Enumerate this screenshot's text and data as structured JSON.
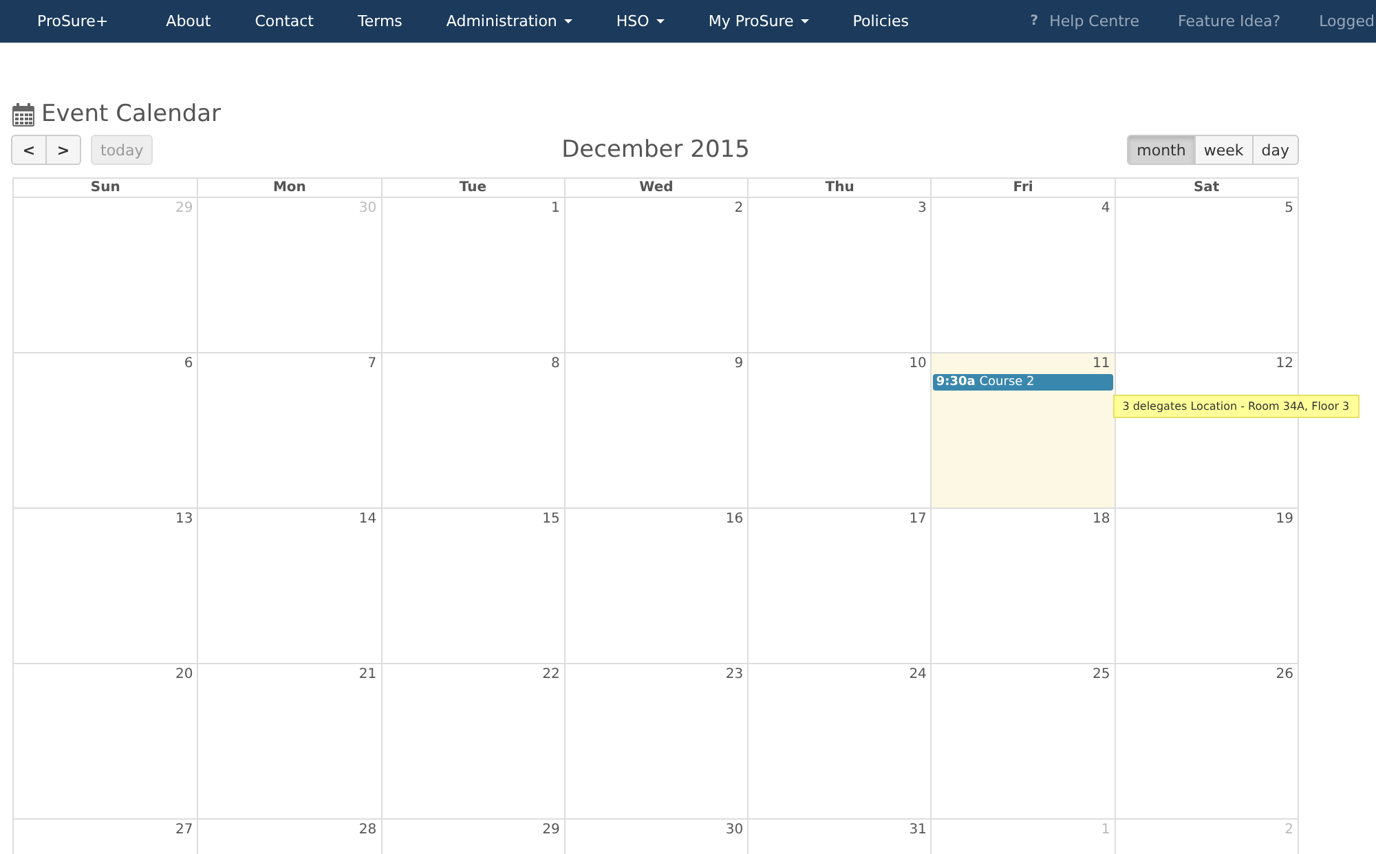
{
  "navbar": {
    "items": [
      {
        "label": "ProSure+",
        "dropdown": false
      },
      {
        "label": "About",
        "dropdown": false
      },
      {
        "label": "Contact",
        "dropdown": false
      },
      {
        "label": "Terms",
        "dropdown": false
      },
      {
        "label": "Administration",
        "dropdown": true
      },
      {
        "label": "HSO",
        "dropdown": true
      },
      {
        "label": "My ProSure",
        "dropdown": true
      },
      {
        "label": "Policies",
        "dropdown": false
      }
    ],
    "right_items": [
      {
        "label": "Help Centre",
        "icon": "?"
      },
      {
        "label": "Feature Idea?"
      },
      {
        "label": "Logged"
      }
    ]
  },
  "page_title": "Event Calendar",
  "toolbar": {
    "prev": "<",
    "next": ">",
    "today": {
      "label": "today",
      "disabled": true
    },
    "title": "December 2015",
    "views": [
      {
        "label": "month",
        "selected": true
      },
      {
        "label": "week",
        "selected": false
      },
      {
        "label": "day",
        "selected": false
      }
    ]
  },
  "calendar": {
    "weekdays": [
      "Sun",
      "Mon",
      "Tue",
      "Wed",
      "Thu",
      "Fri",
      "Sat"
    ],
    "weeks": [
      [
        {
          "day": "29",
          "other_month": true,
          "today": false
        },
        {
          "day": "30",
          "other_month": true,
          "today": false
        },
        {
          "day": "1",
          "other_month": false,
          "today": false
        },
        {
          "day": "2",
          "other_month": false,
          "today": false
        },
        {
          "day": "3",
          "other_month": false,
          "today": false
        },
        {
          "day": "4",
          "other_month": false,
          "today": false
        },
        {
          "day": "5",
          "other_month": false,
          "today": false
        }
      ],
      [
        {
          "day": "6",
          "other_month": false,
          "today": false
        },
        {
          "day": "7",
          "other_month": false,
          "today": false
        },
        {
          "day": "8",
          "other_month": false,
          "today": false
        },
        {
          "day": "9",
          "other_month": false,
          "today": false
        },
        {
          "day": "10",
          "other_month": false,
          "today": false
        },
        {
          "day": "11",
          "other_month": false,
          "today": true,
          "events": [
            {
              "time": "9:30a",
              "title": "Course 2",
              "tooltip": "3 delegates Location - Room 34A, Floor 3"
            }
          ]
        },
        {
          "day": "12",
          "other_month": false,
          "today": false
        }
      ],
      [
        {
          "day": "13",
          "other_month": false,
          "today": false
        },
        {
          "day": "14",
          "other_month": false,
          "today": false
        },
        {
          "day": "15",
          "other_month": false,
          "today": false
        },
        {
          "day": "16",
          "other_month": false,
          "today": false
        },
        {
          "day": "17",
          "other_month": false,
          "today": false
        },
        {
          "day": "18",
          "other_month": false,
          "today": false
        },
        {
          "day": "19",
          "other_month": false,
          "today": false
        }
      ],
      [
        {
          "day": "20",
          "other_month": false,
          "today": false
        },
        {
          "day": "21",
          "other_month": false,
          "today": false
        },
        {
          "day": "22",
          "other_month": false,
          "today": false
        },
        {
          "day": "23",
          "other_month": false,
          "today": false
        },
        {
          "day": "24",
          "other_month": false,
          "today": false
        },
        {
          "day": "25",
          "other_month": false,
          "today": false
        },
        {
          "day": "26",
          "other_month": false,
          "today": false
        }
      ],
      [
        {
          "day": "27",
          "other_month": false,
          "today": false
        },
        {
          "day": "28",
          "other_month": false,
          "today": false
        },
        {
          "day": "29",
          "other_month": false,
          "today": false
        },
        {
          "day": "30",
          "other_month": false,
          "today": false
        },
        {
          "day": "31",
          "other_month": false,
          "today": false
        },
        {
          "day": "1",
          "other_month": true,
          "today": false
        },
        {
          "day": "2",
          "other_month": true,
          "today": false
        }
      ]
    ]
  }
}
